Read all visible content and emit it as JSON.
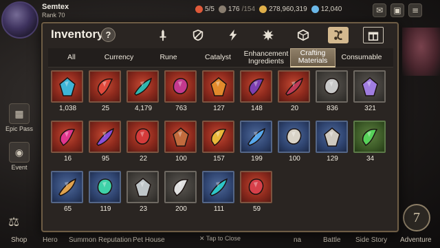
{
  "player": {
    "name": "Semtex",
    "rank": "Rank 70"
  },
  "resources": {
    "stamina": "5/5",
    "energy_current": "176",
    "energy_max": "/154",
    "gold": "278,960,319",
    "skystone": "12,040"
  },
  "panel": {
    "title": "Inventory",
    "help_label": "?",
    "category_tabs": [
      {
        "icon": "equipment-icon"
      },
      {
        "icon": "artifact-icon"
      },
      {
        "icon": "lightning-icon"
      },
      {
        "icon": "fire-burst-icon"
      },
      {
        "icon": "cube-icon"
      },
      {
        "icon": "materials-icon",
        "active": true
      },
      {
        "icon": "gift-box-icon"
      }
    ],
    "sub_tabs": [
      {
        "label": "All"
      },
      {
        "label": "Currency"
      },
      {
        "label": "Rune"
      },
      {
        "label": "Catalyst"
      },
      {
        "label": "Enhancement Ingredients"
      },
      {
        "label": "Crafting Materials",
        "active": true
      },
      {
        "label": "Consumable"
      }
    ]
  },
  "items": [
    {
      "qty": "1,038",
      "bg": "red",
      "icon": "blue-claw-icon",
      "color": "#3fb4d6"
    },
    {
      "qty": "25",
      "bg": "red",
      "icon": "red-crystal-icon",
      "color": "#e0493c"
    },
    {
      "qty": "4,179",
      "bg": "red",
      "icon": "teal-feather-icon",
      "color": "#2fb7b0"
    },
    {
      "qty": "763",
      "bg": "red",
      "icon": "purple-rose-icon",
      "color": "#c4398f"
    },
    {
      "qty": "127",
      "bg": "red",
      "icon": "orange-leaf-icon",
      "color": "#e28a2c"
    },
    {
      "qty": "148",
      "bg": "red",
      "icon": "purple-horn-icon",
      "color": "#7d3fb0"
    },
    {
      "qty": "20",
      "bg": "red",
      "icon": "rose-claw-icon",
      "color": "#c03a57"
    },
    {
      "qty": "836",
      "bg": "gray",
      "icon": "silver-ingot-icon",
      "color": "#c9c9c9"
    },
    {
      "qty": "321",
      "bg": "gray",
      "icon": "rainbow-crystal-icon",
      "color": "#a07de0"
    },
    {
      "qty": "16",
      "bg": "red",
      "icon": "magenta-rose-icon",
      "color": "#e0368d"
    },
    {
      "qty": "95",
      "bg": "red",
      "icon": "violet-crystal-icon",
      "color": "#8a4fd6"
    },
    {
      "qty": "22",
      "bg": "red",
      "icon": "crimson-feather-icon",
      "color": "#d43b3b"
    },
    {
      "qty": "100",
      "bg": "red",
      "icon": "copper-leaf-icon",
      "color": "#c26b3d"
    },
    {
      "qty": "157",
      "bg": "red",
      "icon": "golden-rose-icon",
      "color": "#e8b73a"
    },
    {
      "qty": "199",
      "bg": "blue",
      "icon": "blue-crystal-icon",
      "color": "#57a8ec"
    },
    {
      "qty": "100",
      "bg": "blue",
      "icon": "bone-claw-icon",
      "color": "#d9d3c7"
    },
    {
      "qty": "129",
      "bg": "blue",
      "icon": "bone-crystal-icon",
      "color": "#cfcac0"
    },
    {
      "qty": "34",
      "bg": "green",
      "icon": "green-rose-icon",
      "color": "#57d159"
    },
    {
      "qty": "65",
      "bg": "blue",
      "icon": "amber-horn-icon",
      "color": "#e0a24d"
    },
    {
      "qty": "119",
      "bg": "blue",
      "icon": "emerald-crystal-icon",
      "color": "#3fd1a8"
    },
    {
      "qty": "23",
      "bg": "gray",
      "icon": "steel-leaf-icon",
      "color": "#bfc6c9"
    },
    {
      "qty": "200",
      "bg": "gray",
      "icon": "silver-crystal-icon",
      "color": "#e0e0e0"
    },
    {
      "qty": "111",
      "bg": "blue",
      "icon": "cyan-claw-icon",
      "color": "#2ec4c7"
    },
    {
      "qty": "59",
      "bg": "red",
      "icon": "scarlet-horn-icon",
      "color": "#d6404a"
    }
  ],
  "bottom_nav": [
    "Shop",
    "Hero",
    "Summon",
    "Reputation",
    "Pet House",
    "na",
    "Battle",
    "Side Story",
    "Adventure"
  ],
  "close_hint": "Tap to Close",
  "side_menu": [
    "Epic Pass",
    "Event"
  ]
}
